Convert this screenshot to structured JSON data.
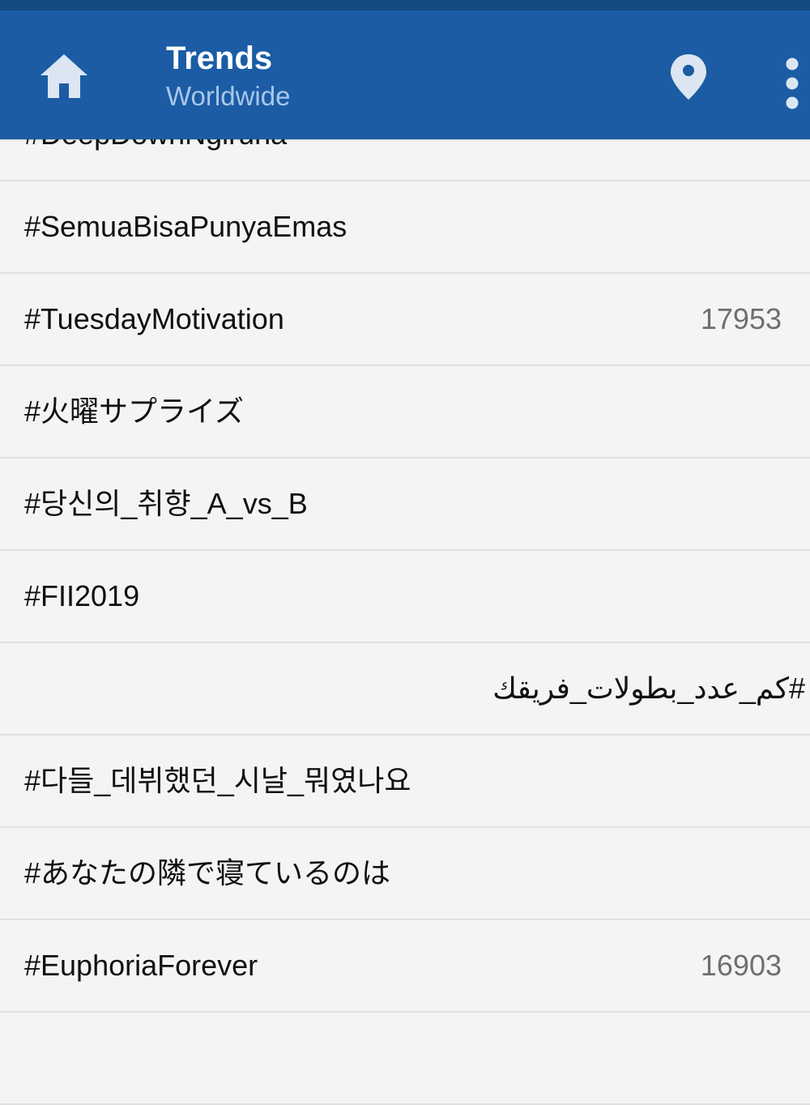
{
  "app_bar": {
    "title": "Trends",
    "subtitle": "Worldwide",
    "icons": {
      "home": "home-icon",
      "location": "map-pin-icon",
      "more": "more-vertical-icon"
    },
    "colors": {
      "background": "#1b5ca4",
      "status_bar": "#154a82",
      "title": "#ffffff",
      "subtitle": "#a9c6ea",
      "icon": "#dce6f2"
    }
  },
  "trends": [
    {
      "name": "#DeepDownNgiruna",
      "count": ""
    },
    {
      "name": "#SemuaBisaPunyaEmas",
      "count": ""
    },
    {
      "name": "#TuesdayMotivation",
      "count": "17953"
    },
    {
      "name": "#火曜サプライズ",
      "count": ""
    },
    {
      "name": "#당신의_취향_A_vs_B",
      "count": ""
    },
    {
      "name": "#FII2019",
      "count": ""
    },
    {
      "name": "#كم_عدد_بطولات_فريقك",
      "count": "",
      "rtl": true
    },
    {
      "name": "#다들_데뷔했던_시날_뭐였나요",
      "count": ""
    },
    {
      "name": "#あなたの隣で寝ているのは",
      "count": ""
    },
    {
      "name": "#EuphoriaForever",
      "count": "16903"
    },
    {
      "name": "",
      "count": ""
    }
  ]
}
